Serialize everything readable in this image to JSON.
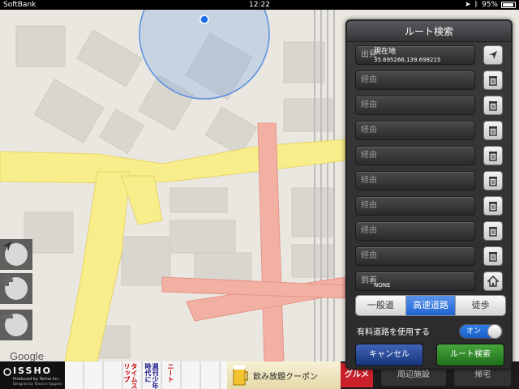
{
  "status_bar": {
    "carrier": "SoftBank",
    "time": "12:22",
    "battery_text": "95%",
    "battery_level": 0.95
  },
  "map": {
    "logo": "Google",
    "controls": [
      "current-location-arrow-icon",
      "zoom-in-icon",
      "zoom-out-icon"
    ]
  },
  "panel": {
    "title": "ルート検索",
    "origin": {
      "label": "出発",
      "value": "現在地",
      "coords": "35.695266,139.698215"
    },
    "waypoints": [
      "経由",
      "経由",
      "経由",
      "経由",
      "経由",
      "経由",
      "経由",
      "経由"
    ],
    "destination": {
      "label": "到着",
      "value": "NONE"
    },
    "road_types": [
      "一般道",
      "高速道路",
      "徒歩"
    ],
    "road_type_selected": "高速道路",
    "toll_label": "有料道路を使用する",
    "toll_toggle": "オン",
    "cancel_label": "キャンセル",
    "search_label": "ルート検索"
  },
  "ad_banner": {
    "brand": "ISSHO",
    "produced_by": "Produced by Tamai inc.",
    "designed_by": "Designed by Tamai in Sapporo",
    "manga_texts": [
      "タイムスリップ",
      "週刊少年時代に",
      "ニート"
    ],
    "coupon_text": "飲み放題クーポン",
    "gurume": "グルメ",
    "tabs": [
      "周辺施設",
      "帰宅"
    ]
  },
  "colors": {
    "panel_bg": "#2f2f31",
    "segment_active": "#2a6fdb",
    "cancel_button": "#24448f",
    "search_button": "#2d8a25",
    "highway": "#f7ee8b",
    "main_road": "#f2b0a3"
  }
}
